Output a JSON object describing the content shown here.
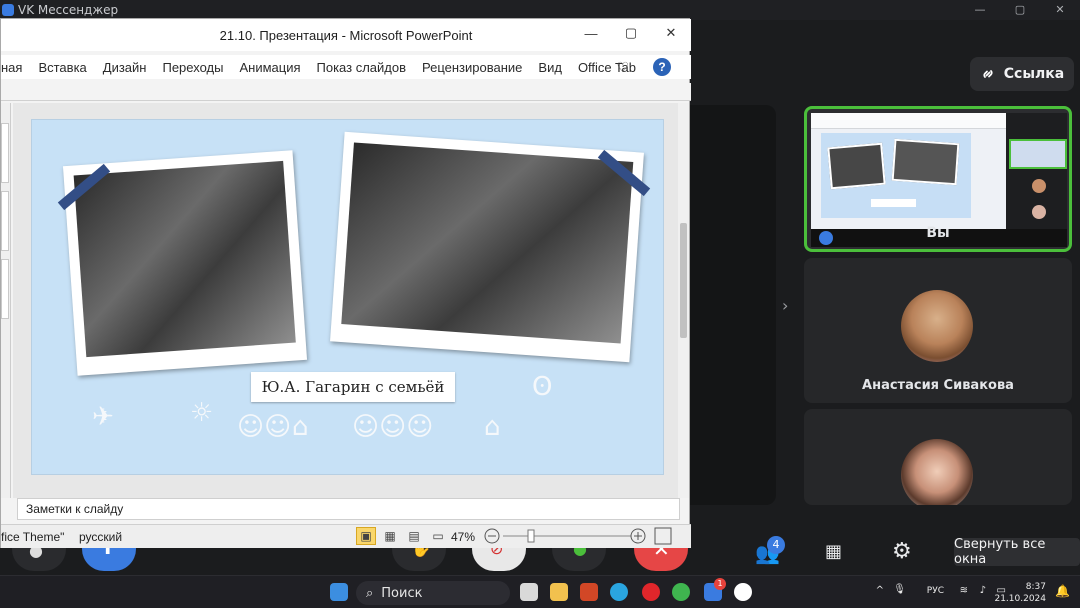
{
  "vk": {
    "title": "VK Мессенджер",
    "link_button": "Ссылка",
    "participants_badge": "4",
    "tooltip": "Свернуть все окна",
    "tiles": {
      "me": "Вы",
      "p2": "Анастасия Сивакова"
    }
  },
  "ppt": {
    "title": "21.10. Презентация - Microsoft PowerPoint",
    "tabs": [
      "ная",
      "Вставка",
      "Дизайн",
      "Переходы",
      "Анимация",
      "Показ слайдов",
      "Рецензирование",
      "Вид",
      "Office Tab"
    ],
    "slide_caption": "Ю.А. Гагарин с семьёй",
    "notes_placeholder": "Заметки к слайду",
    "status": {
      "theme": "fice Theme\"",
      "language": "русский",
      "zoom": "47%"
    }
  },
  "taskbar": {
    "search_label": "Поиск",
    "language": "РУС",
    "time": "8:37",
    "date": "21.10.2024",
    "notification_badge": "1"
  },
  "colors": {
    "accent_green": "#4bbf3b",
    "vk_blue": "#3a7be0",
    "slide_bg": "#c7e1f6"
  }
}
